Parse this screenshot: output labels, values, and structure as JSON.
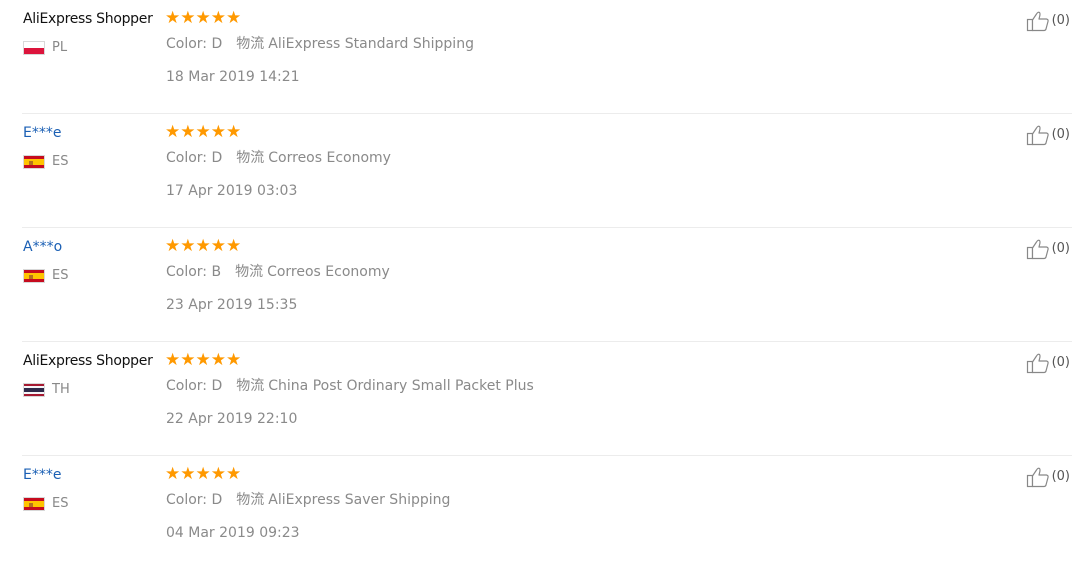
{
  "reviews": [
    {
      "user": "AliExpress Shopper",
      "user_type": "shopper",
      "country_code": "PL",
      "flag": "flag-pl",
      "stars": "★★★★★",
      "color_text": "Color: D",
      "shipping_label": "物流",
      "shipping_method": "AliExpress Standard Shipping",
      "date": "18 Mar 2019 14:21",
      "helpful": "(0)"
    },
    {
      "user": "E***e",
      "user_type": "buyer",
      "country_code": "ES",
      "flag": "flag-es",
      "stars": "★★★★★",
      "color_text": "Color: D",
      "shipping_label": "物流",
      "shipping_method": "Correos Economy",
      "date": "17 Apr 2019 03:03",
      "helpful": "(0)"
    },
    {
      "user": "A***o",
      "user_type": "buyer",
      "country_code": "ES",
      "flag": "flag-es",
      "stars": "★★★★★",
      "color_text": "Color: B",
      "shipping_label": "物流",
      "shipping_method": "Correos Economy",
      "date": "23 Apr 2019 15:35",
      "helpful": "(0)"
    },
    {
      "user": "AliExpress Shopper",
      "user_type": "shopper",
      "country_code": "TH",
      "flag": "flag-th",
      "stars": "★★★★★",
      "color_text": "Color: D",
      "shipping_label": "物流",
      "shipping_method": "China Post Ordinary Small Packet Plus",
      "date": "22 Apr 2019 22:10",
      "helpful": "(0)"
    },
    {
      "user": "E***e",
      "user_type": "buyer",
      "country_code": "ES",
      "flag": "flag-es",
      "stars": "★★★★★",
      "color_text": "Color: D",
      "shipping_label": "物流",
      "shipping_method": "AliExpress Saver Shipping",
      "date": "04 Mar 2019 09:23",
      "helpful": "(0)"
    }
  ],
  "icons": {
    "rating": "star-icon",
    "helpful": "thumbs-up-icon"
  },
  "colors": {
    "star": "#ff9900",
    "buyer_link": "#1a5fb4",
    "meta_text": "#8a8a8a",
    "divider": "#ececec"
  }
}
